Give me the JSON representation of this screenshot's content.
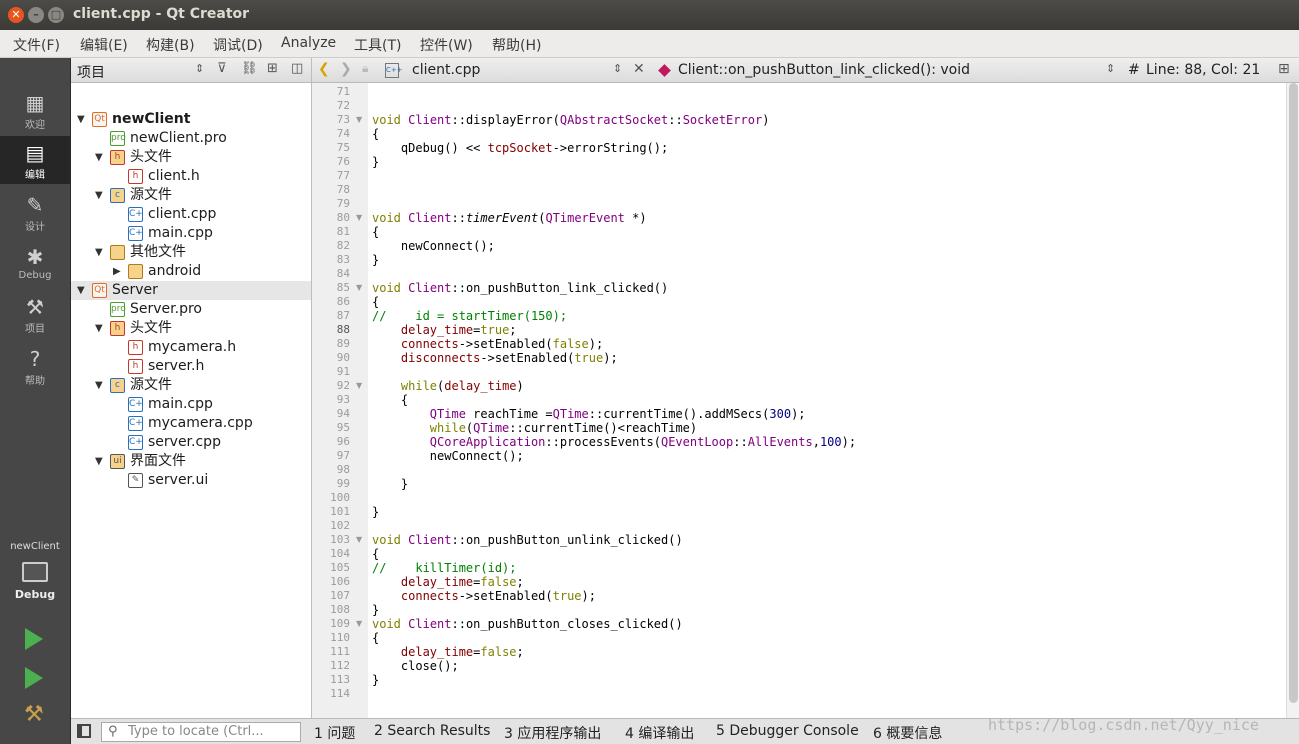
{
  "window": {
    "title": "client.cpp - Qt Creator"
  },
  "menu": [
    "文件(F)",
    "编辑(E)",
    "构建(B)",
    "调试(D)",
    "Analyze",
    "工具(T)",
    "控件(W)",
    "帮助(H)"
  ],
  "modes": [
    {
      "label": "欢迎",
      "icon": "grid-icon"
    },
    {
      "label": "编辑",
      "icon": "document-icon"
    },
    {
      "label": "设计",
      "icon": "pencil-icon"
    },
    {
      "label": "Debug",
      "icon": "bug-icon"
    },
    {
      "label": "项目",
      "icon": "wrench-icon"
    },
    {
      "label": "帮助",
      "icon": "help-icon"
    }
  ],
  "kit": {
    "project": "newClient",
    "config": "Debug"
  },
  "project_pane": {
    "title": "项目",
    "tree": [
      {
        "label": "newClient",
        "depth": 0,
        "arrow": "▼",
        "icon": "qt",
        "bold": true
      },
      {
        "label": "newClient.pro",
        "depth": 1,
        "arrow": "",
        "icon": "pro"
      },
      {
        "label": "头文件",
        "depth": 1,
        "arrow": "▼",
        "icon": "h-folder"
      },
      {
        "label": "client.h",
        "depth": 2,
        "arrow": "",
        "icon": "h"
      },
      {
        "label": "源文件",
        "depth": 1,
        "arrow": "▼",
        "icon": "cpp-folder"
      },
      {
        "label": "client.cpp",
        "depth": 2,
        "arrow": "",
        "icon": "cpp"
      },
      {
        "label": "main.cpp",
        "depth": 2,
        "arrow": "",
        "icon": "cpp"
      },
      {
        "label": "其他文件",
        "depth": 1,
        "arrow": "▼",
        "icon": "folder"
      },
      {
        "label": "android",
        "depth": 2,
        "arrow": "▶",
        "icon": "folder"
      },
      {
        "label": "Server",
        "depth": 0,
        "arrow": "▼",
        "icon": "qt",
        "selected": true
      },
      {
        "label": "Server.pro",
        "depth": 1,
        "arrow": "",
        "icon": "pro"
      },
      {
        "label": "头文件",
        "depth": 1,
        "arrow": "▼",
        "icon": "h-folder"
      },
      {
        "label": "mycamera.h",
        "depth": 2,
        "arrow": "",
        "icon": "h"
      },
      {
        "label": "server.h",
        "depth": 2,
        "arrow": "",
        "icon": "h"
      },
      {
        "label": "源文件",
        "depth": 1,
        "arrow": "▼",
        "icon": "cpp-folder"
      },
      {
        "label": "main.cpp",
        "depth": 2,
        "arrow": "",
        "icon": "cpp"
      },
      {
        "label": "mycamera.cpp",
        "depth": 2,
        "arrow": "",
        "icon": "cpp"
      },
      {
        "label": "server.cpp",
        "depth": 2,
        "arrow": "",
        "icon": "cpp"
      },
      {
        "label": "界面文件",
        "depth": 1,
        "arrow": "▼",
        "icon": "ui-folder"
      },
      {
        "label": "server.ui",
        "depth": 2,
        "arrow": "",
        "icon": "ui"
      }
    ]
  },
  "editor": {
    "file": "client.cpp",
    "symbol": "Client::on_pushButton_link_clicked(): void",
    "position": "Line: 88, Col: 21",
    "hash": "#",
    "lines": [
      [
        71,
        ""
      ],
      [
        72,
        ""
      ],
      [
        73,
        "<span class='kw'>void</span> <span class='ty'>Client</span>::displayError(<span class='ty'>QAbstractSocket</span>::<span class='ty'>SocketError</span>)"
      ],
      [
        74,
        "{"
      ],
      [
        75,
        "    qDebug() &lt;&lt; <span class='var'>tcpSocket</span>-&gt;errorString();"
      ],
      [
        76,
        "}"
      ],
      [
        77,
        ""
      ],
      [
        78,
        ""
      ],
      [
        79,
        ""
      ],
      [
        80,
        "<span class='kw'>void</span> <span class='ty'>Client</span>::<span class='fn'>timerEvent</span>(<span class='ty'>QTimerEvent</span> *)"
      ],
      [
        81,
        "{"
      ],
      [
        82,
        "    newConnect();"
      ],
      [
        83,
        "}"
      ],
      [
        84,
        ""
      ],
      [
        85,
        "<span class='kw'>void</span> <span class='ty'>Client</span>::on_pushButton_link_clicked()"
      ],
      [
        86,
        "{"
      ],
      [
        87,
        "<span class='cm'>//    id = startTimer(150);</span>"
      ],
      [
        88,
        "    <span class='var'>delay_time</span>=<span class='kw'>true</span>;"
      ],
      [
        89,
        "    <span class='var'>connects</span>-&gt;setEnabled(<span class='kw'>false</span>);"
      ],
      [
        90,
        "    <span class='var'>disconnects</span>-&gt;setEnabled(<span class='kw'>true</span>);"
      ],
      [
        91,
        ""
      ],
      [
        92,
        "    <span class='kw'>while</span>(<span class='var'>delay_time</span>)"
      ],
      [
        93,
        "    {"
      ],
      [
        94,
        "        <span class='ty'>QTime</span> reachTime =<span class='ty'>QTime</span>::currentTime().addMSecs(<span class='num'>300</span>);"
      ],
      [
        95,
        "        <span class='kw'>while</span>(<span class='ty'>QTime</span>::currentTime()&lt;reachTime)"
      ],
      [
        96,
        "        <span class='ty'>QCoreApplication</span>::processEvents(<span class='ty'>QEventLoop</span>::<span class='ty'>AllEvents</span>,<span class='num'>100</span>);"
      ],
      [
        97,
        "        newConnect();"
      ],
      [
        98,
        ""
      ],
      [
        99,
        "    }"
      ],
      [
        100,
        ""
      ],
      [
        101,
        "}"
      ],
      [
        102,
        ""
      ],
      [
        103,
        "<span class='kw'>void</span> <span class='ty'>Client</span>::on_pushButton_unlink_clicked()"
      ],
      [
        104,
        "{"
      ],
      [
        105,
        "<span class='cm'>//    killTimer(id);</span>"
      ],
      [
        106,
        "    <span class='var'>delay_time</span>=<span class='kw'>false</span>;"
      ],
      [
        107,
        "    <span class='var'>connects</span>-&gt;setEnabled(<span class='kw'>true</span>);"
      ],
      [
        108,
        "}"
      ],
      [
        109,
        "<span class='kw'>void</span> <span class='ty'>Client</span>::on_pushButton_closes_clicked()"
      ],
      [
        110,
        "{"
      ],
      [
        111,
        "    <span class='var'>delay_time</span>=<span class='kw'>false</span>;"
      ],
      [
        112,
        "    close();"
      ],
      [
        113,
        "}"
      ],
      [
        114,
        ""
      ]
    ],
    "fold_lines": [
      73,
      80,
      85,
      92,
      103,
      109
    ]
  },
  "output_tabs": [
    "1 问题",
    "2 Search Results",
    "3 应用程序输出",
    "4 编译输出",
    "5 Debugger Console",
    "6 概要信息"
  ],
  "locate": {
    "placeholder": "Type to locate (Ctrl..."
  },
  "watermark": "https://blog.csdn.net/Qyy_nice"
}
